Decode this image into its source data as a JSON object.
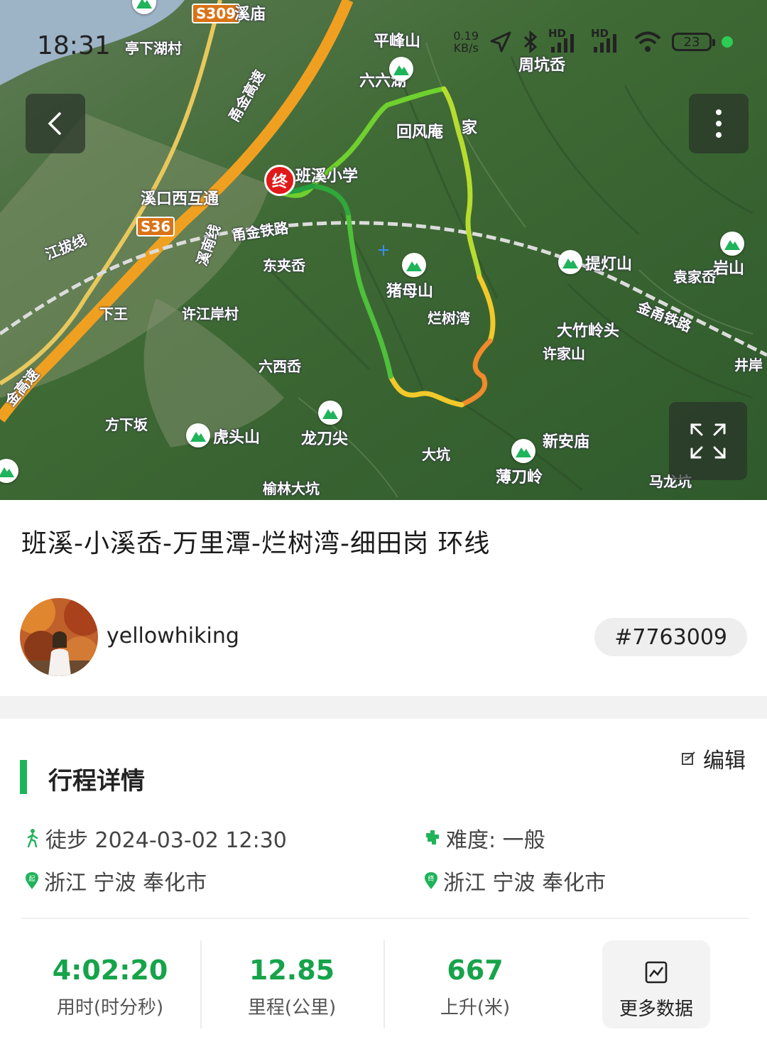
{
  "status_bar": {
    "time": "18:31",
    "net_speed_value": "0.19",
    "net_speed_unit": "KB/s",
    "signal_1": "HD",
    "signal_2": "HD",
    "battery": "23"
  },
  "map": {
    "end_marker": "终",
    "labels": [
      {
        "text": "亭下湖村"
      },
      {
        "text": "S309"
      },
      {
        "text": "溪庙"
      },
      {
        "text": "甬金高速"
      },
      {
        "text": "平峰山"
      },
      {
        "text": "六六湖"
      },
      {
        "text": "回风庵"
      },
      {
        "text": "家"
      },
      {
        "text": "班溪小学"
      },
      {
        "text": "溪口西互通"
      },
      {
        "text": "S36"
      },
      {
        "text": "江拔线"
      },
      {
        "text": "甬金铁路"
      },
      {
        "text": "溪南线"
      },
      {
        "text": "东夹岙"
      },
      {
        "text": "猪母山"
      },
      {
        "text": "提灯山"
      },
      {
        "text": "袁家岙"
      },
      {
        "text": "岩山"
      },
      {
        "text": "下王"
      },
      {
        "text": "许江岸村"
      },
      {
        "text": "烂树湾"
      },
      {
        "text": "金甬铁路"
      },
      {
        "text": "大竹岭头"
      },
      {
        "text": "许家山"
      },
      {
        "text": "六西岙"
      },
      {
        "text": "井岸"
      },
      {
        "text": "金高速"
      },
      {
        "text": "方下坂"
      },
      {
        "text": "虎头山"
      },
      {
        "text": "龙刀尖"
      },
      {
        "text": "大坑"
      },
      {
        "text": "新安庙"
      },
      {
        "text": "薄刀岭"
      },
      {
        "text": "马龙坑"
      },
      {
        "text": "榆林大坑"
      },
      {
        "text": "周坑岙"
      }
    ]
  },
  "trip": {
    "title": "班溪-小溪岙-万里潭-烂树湾-细田岗 环线",
    "username": "yellowhiking",
    "id": "#7763009"
  },
  "details": {
    "section_title": "行程详情",
    "edit_label": "编辑",
    "activity": "徒步 2024-03-02 12:30",
    "difficulty": "难度: 一般",
    "start_location": "浙江 宁波 奉化市",
    "end_location": "浙江 宁波 奉化市"
  },
  "stats": [
    {
      "value": "4:02:20",
      "label": "用时(时分秒)"
    },
    {
      "value": "12.85",
      "label": "里程(公里)"
    },
    {
      "value": "667",
      "label": "上升(米)"
    }
  ],
  "more_data_label": "更多数据",
  "colors": {
    "accent_green": "#1fb35a",
    "stat_green": "#16a34a",
    "end_marker_red": "#e01a1a"
  }
}
